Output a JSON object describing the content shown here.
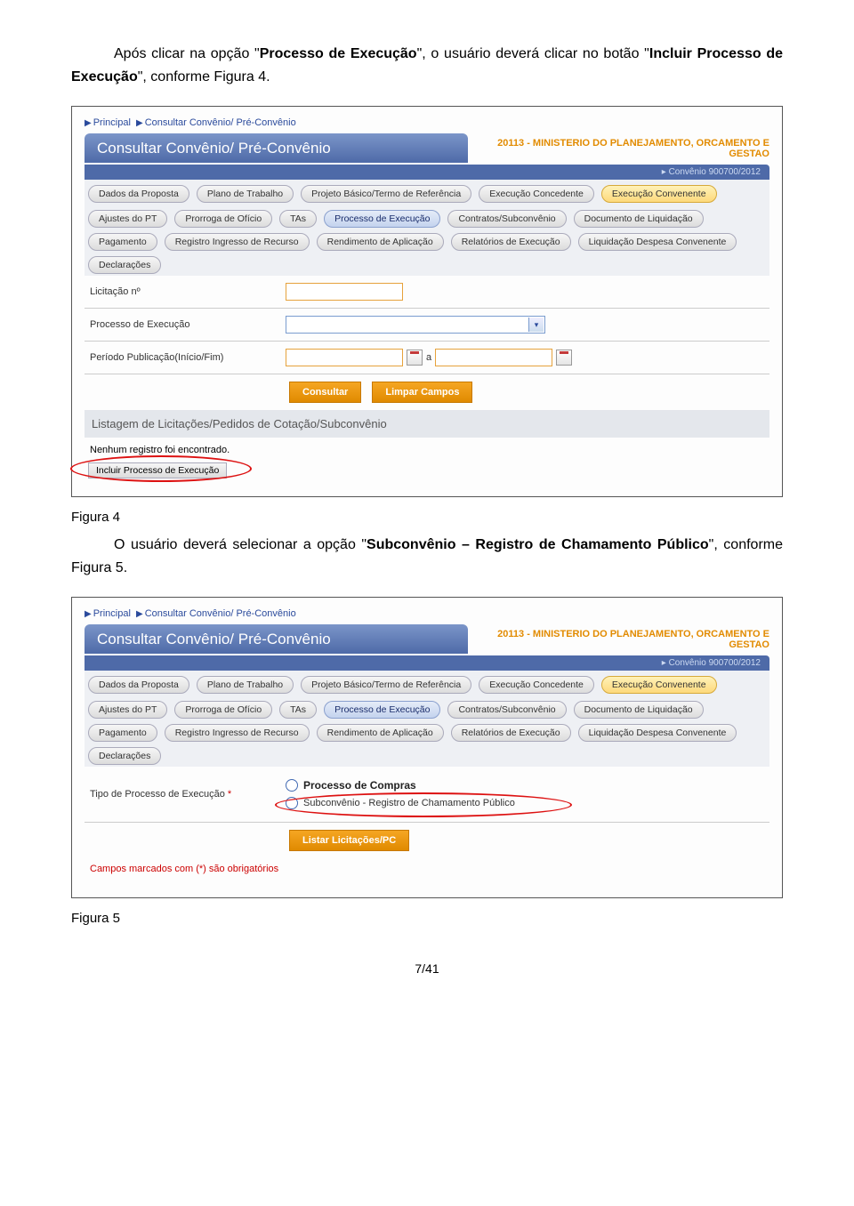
{
  "para1": {
    "lead": "Após clicar na opção \"",
    "b1": "Processo de Execução",
    "mid": "\", o usuário deverá clicar no botão \"",
    "b2": "Incluir Processo de Execução",
    "tail": "\", conforme Figura 4."
  },
  "shot1": {
    "breadcrumb": {
      "a": "Principal",
      "b": "Consultar Convênio/ Pré-Convênio"
    },
    "title": "Consultar Convênio/ Pré-Convênio",
    "org": "20113 - MINISTERIO DO PLANEJAMENTO, ORCAMENTO E GESTAO",
    "sub": "▸ Convênio 900700/2012",
    "tabsA": [
      "Dados da Proposta",
      "Plano de Trabalho",
      "Projeto Básico/Termo de Referência",
      "Execução Concedente",
      "Execução Convenente"
    ],
    "tabsB": [
      "Ajustes do PT",
      "Prorroga de Ofício",
      "TAs",
      "Processo de Execução",
      "Contratos/Subconvênio",
      "Documento de Liquidação",
      "Pagamento",
      "Registro Ingresso de Recurso",
      "Rendimento de Aplicação",
      "Relatórios de Execução",
      "Liquidação Despesa Convenente",
      "Declarações"
    ],
    "filters": {
      "lic": "Licitação nº",
      "proc": "Processo de Execução",
      "per": "Período Publicação(Início/Fim)",
      "sep": "a"
    },
    "buttons": {
      "consultar": "Consultar",
      "limpar": "Limpar Campos"
    },
    "listHead": "Listagem de Licitações/Pedidos de Cotação/Subconvênio",
    "noResult": "Nenhum registro foi encontrado.",
    "incluir": "Incluir Processo de Execução"
  },
  "figcap1": "Figura 4",
  "para2": {
    "lead": "O usuário deverá selecionar a opção \"",
    "b1": "Subconvênio – Registro de Chamamento Público",
    "tail": "\", conforme Figura 5."
  },
  "shot2": {
    "breadcrumb": {
      "a": "Principal",
      "b": "Consultar Convênio/ Pré-Convênio"
    },
    "title": "Consultar Convênio/ Pré-Convênio",
    "org": "20113 - MINISTERIO DO PLANEJAMENTO, ORCAMENTO E GESTAO",
    "sub": "▸ Convênio 900700/2012",
    "tabsA": [
      "Dados da Proposta",
      "Plano de Trabalho",
      "Projeto Básico/Termo de Referência",
      "Execução Concedente",
      "Execução Convenente"
    ],
    "tabsB": [
      "Ajustes do PT",
      "Prorroga de Ofício",
      "TAs",
      "Processo de Execução",
      "Contratos/Subconvênio",
      "Documento de Liquidação",
      "Pagamento",
      "Registro Ingresso de Recurso",
      "Rendimento de Aplicação",
      "Relatórios de Execução",
      "Liquidação Despesa Convenente",
      "Declarações"
    ],
    "typeLabel": "Tipo de Processo de Execução",
    "req": "*",
    "opt1": "Processo de Compras",
    "opt2": "Subconvênio - Registro de Chamamento Público",
    "listar": "Listar Licitações/PC",
    "oblig": "Campos marcados com (*) são obrigatórios"
  },
  "figcap2": "Figura 5",
  "pageNum": "7/41"
}
